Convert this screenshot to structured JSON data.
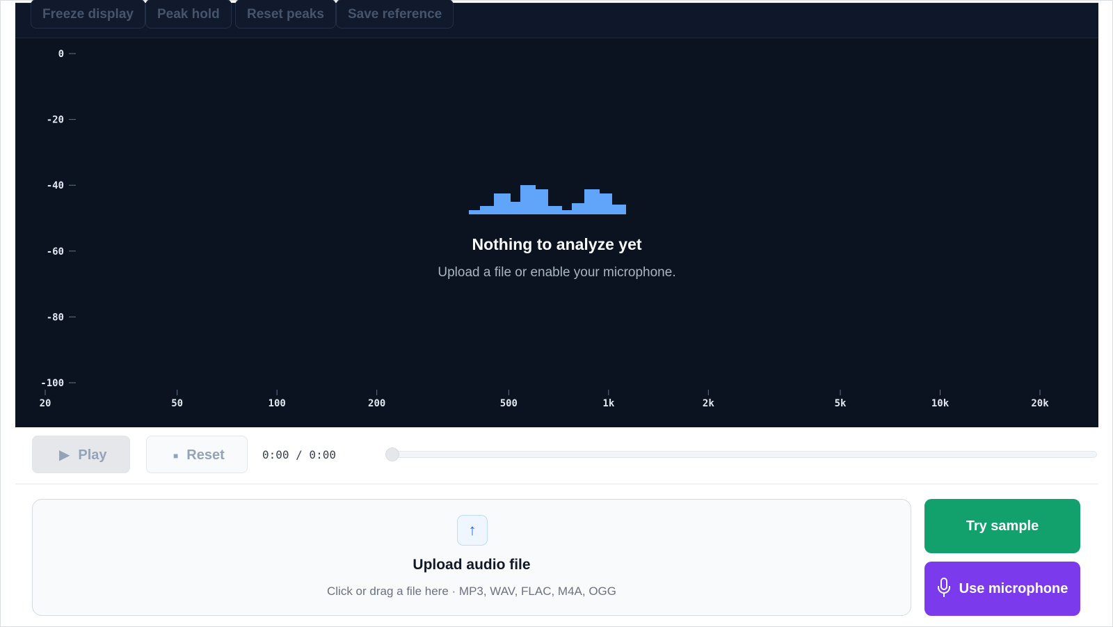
{
  "toolbar": {
    "freeze_label": "Freeze display",
    "peak_hold_label": "Peak hold",
    "reset_peaks_label": "Reset peaks",
    "save_reference_label": "Save reference"
  },
  "chart_data": {
    "type": "line",
    "title": "",
    "xlabel": "",
    "ylabel": "",
    "x_scale": "log",
    "xlim": [
      20,
      20000
    ],
    "ylim": [
      -100,
      0
    ],
    "x_ticks": [
      20,
      50,
      100,
      200,
      500,
      1000,
      2000,
      5000,
      10000,
      20000
    ],
    "x_tick_labels": [
      "20",
      "50",
      "100",
      "200",
      "500",
      "1k",
      "2k",
      "5k",
      "10k",
      "20k"
    ],
    "y_ticks": [
      0,
      -20,
      -40,
      -60,
      -80,
      -100
    ],
    "y_tick_labels": [
      "0",
      "-20",
      "-40",
      "-60",
      "-80",
      "-100"
    ],
    "series": [],
    "grid": false,
    "legend": "none"
  },
  "empty_state": {
    "icon": "spectrum-bars-icon",
    "icon_color": "#60a5fa",
    "title": "Nothing to analyze yet",
    "subtitle": "Upload a file or enable your microphone."
  },
  "transport": {
    "play_label": "Play",
    "reset_label": "Reset",
    "time": "0:00 / 0:00",
    "progress": 0
  },
  "upload": {
    "icon": "upload-arrow-icon",
    "title": "Upload audio file",
    "subtitle": "Click or drag a file here · MP3, WAV, FLAC, M4A, OGG"
  },
  "actions": {
    "sample_label": "Try sample",
    "microphone_label": "Use microphone",
    "sample_color": "#12a06c",
    "microphone_color": "#7c3aed"
  },
  "colors": {
    "panel_bg": "#0b1220",
    "toolbar_bg": "#0f172a",
    "accent": "#60a5fa"
  }
}
